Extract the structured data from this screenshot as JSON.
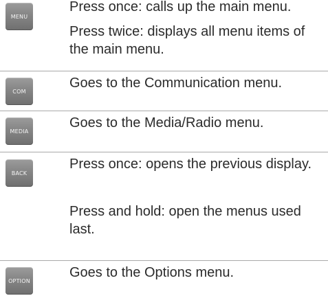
{
  "rows": [
    {
      "key": "MENU",
      "paragraphs": [
        "Press once: calls up the main menu.",
        "Press twice: displays all menu items of the main menu."
      ]
    },
    {
      "key": "COM",
      "paragraphs": [
        "Goes to the Communication menu."
      ]
    },
    {
      "key": "MEDIA",
      "paragraphs": [
        "Goes to the Media/Radio menu."
      ]
    },
    {
      "key": "BACK",
      "paragraphs": [
        "Press once: opens the previous dis­play.",
        "Press and hold: open the menus used last."
      ]
    },
    {
      "key": "OPTION",
      "paragraphs": [
        "Goes to the Options menu."
      ]
    }
  ]
}
